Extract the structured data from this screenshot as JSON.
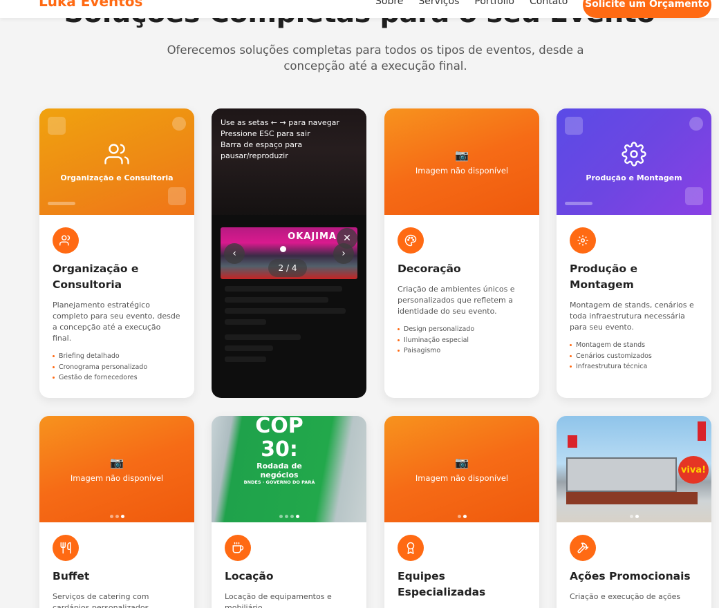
{
  "header": {
    "logo": "Luka Eventos",
    "nav": [
      "Sobre",
      "Serviços",
      "Portfólio",
      "Contato"
    ],
    "cta": "Solicite um Orçamento"
  },
  "hero": {
    "title": "Soluções Completas para o seu Evento",
    "subtitle": "Oferecemos soluções completas para todos os tipos de eventos, desde a concepção até a execução final."
  },
  "colors": {
    "accent": "#ff6a13"
  },
  "cards": {
    "c1": {
      "media_label": "Organização e Consultoria",
      "title": "Organização e Consultoria",
      "desc": "Planejamento estratégico completo para seu evento, desde a concepção até a execução final.",
      "features": [
        "Briefing detalhado",
        "Cronograma personalizado",
        "Gestão de fornecedores"
      ],
      "icon": "users-icon"
    },
    "c2": {
      "lightbox_help": [
        "Use as setas ← → para navegar",
        "Pressione ESC para sair",
        "Barra de espaço para pausar/reproduzir"
      ],
      "lightbox_brand": "OKAJIMA",
      "counter": "2 / 4"
    },
    "c3": {
      "media_na": "Imagem não disponível",
      "title": "Decoração",
      "desc": "Criação de ambientes únicos e personalizados que refletem a identidade do seu evento.",
      "features": [
        "Design personalizado",
        "Iluminação especial",
        "Paisagismo"
      ],
      "icon": "palette-icon"
    },
    "c4": {
      "media_label": "Produção e Montagem",
      "title": "Produção e Montagem",
      "desc": "Montagem de stands, cenários e toda infraestrutura necessária para seu evento.",
      "features": [
        "Montagem de stands",
        "Cenários customizados",
        "Infraestrutura técnica"
      ],
      "icon": "gear-icon"
    },
    "c5": {
      "media_na": "Imagem não disponível",
      "title": "Buffet",
      "desc": "Serviços de catering com cardápios personalizados",
      "icon": "utensils-icon"
    },
    "c6": {
      "photo_text": [
        "COP 30:",
        "Rodada de negócios",
        "BNDES · GOVERNO DO PARÁ"
      ],
      "title": "Locação",
      "desc": "Locação de equipamentos e mobiliário",
      "icon": "coffee-icon"
    },
    "c7": {
      "media_na": "Imagem não disponível",
      "title": "Equipes Especializadas",
      "icon": "award-icon"
    },
    "c8": {
      "photo_text": "viva!",
      "title": "Ações Promocionais",
      "desc": "Criação e execução de ações",
      "icon": "hammer-icon"
    }
  }
}
